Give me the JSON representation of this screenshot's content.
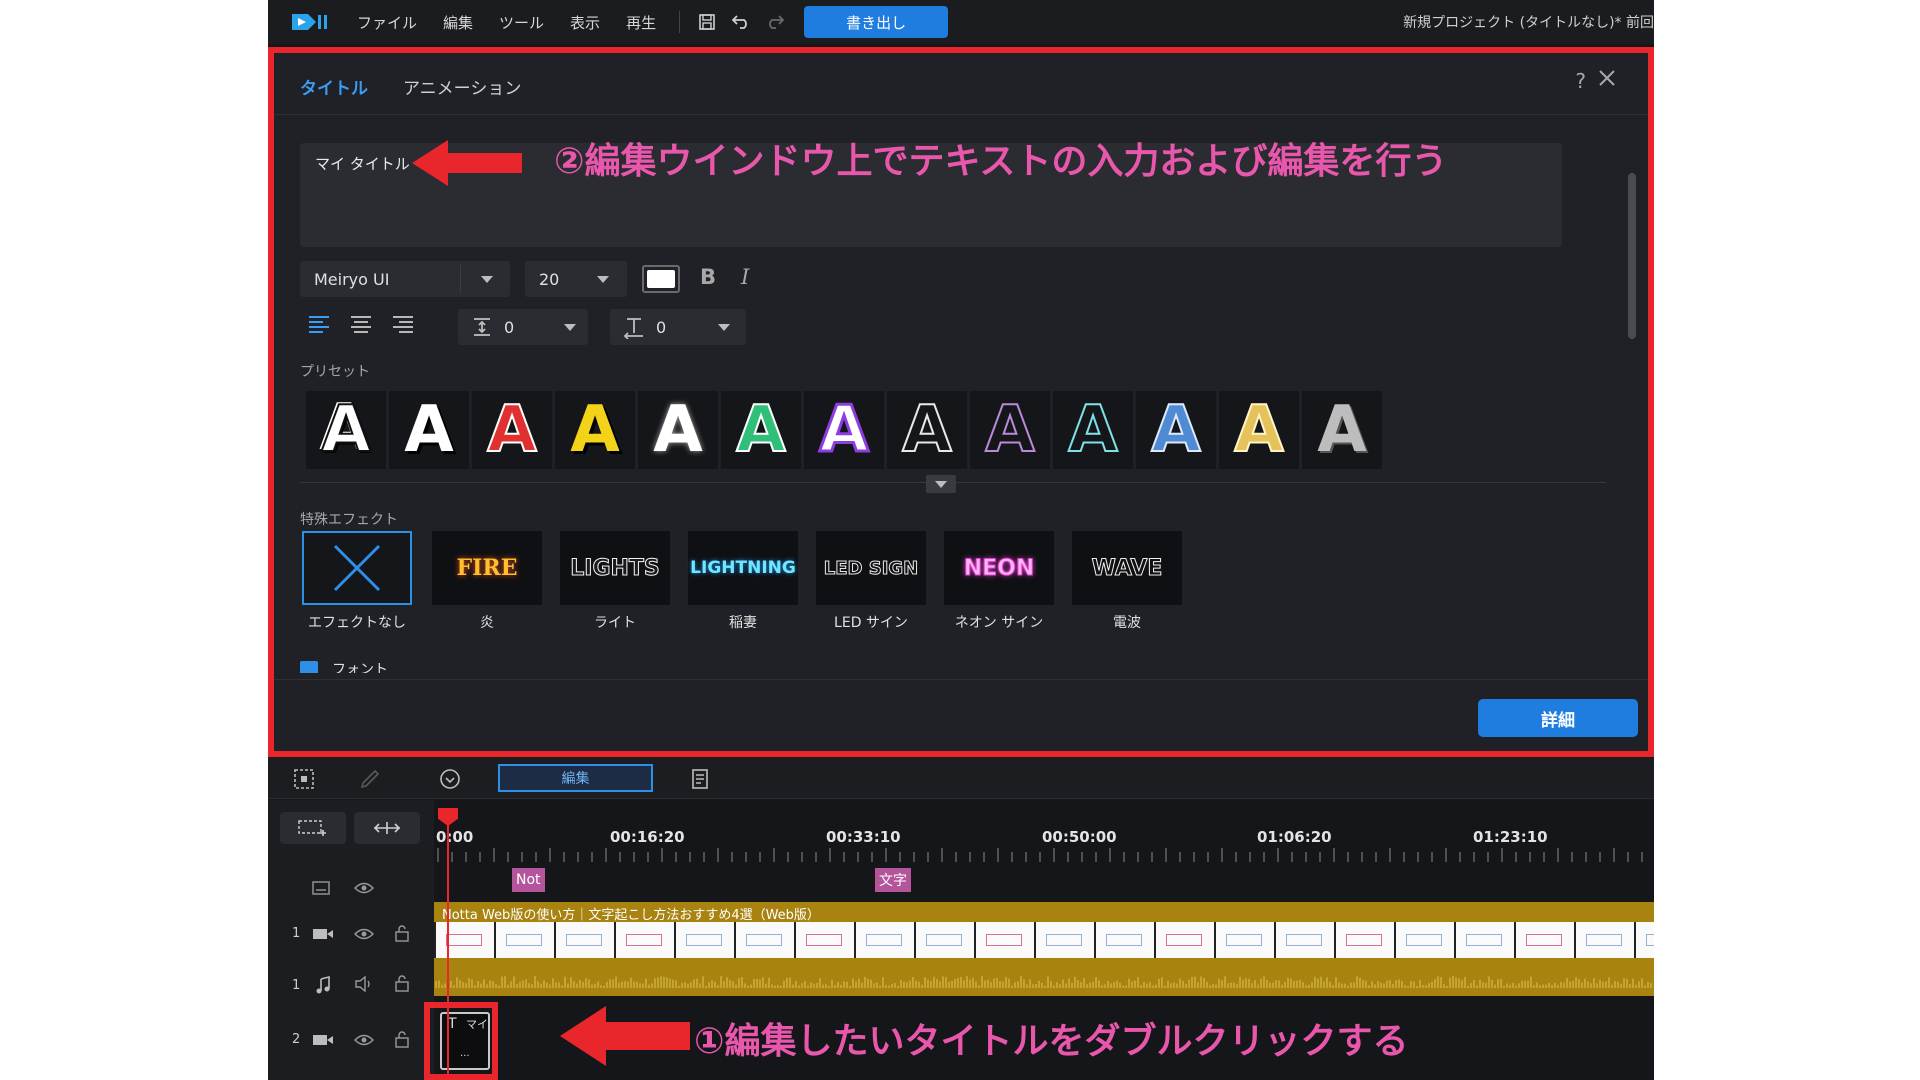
{
  "menu": {
    "items": [
      "ファイル",
      "編集",
      "ツール",
      "表示",
      "再生"
    ],
    "export_label": "書き出し",
    "project_title": "新規プロジェクト (タイトルなし)* 前回"
  },
  "editor": {
    "tabs": {
      "title": "タイトル",
      "animation": "アニメーション"
    },
    "help": "?",
    "text_value": "マイ タイトル",
    "font": "Meiryo UI",
    "size": "20",
    "bold": "B",
    "italic": "I",
    "line_spacing": "0",
    "char_spacing": "0",
    "preset_label": "プリセット",
    "effect_label": "特殊エフェクト",
    "font_section_label": "フォント",
    "details_label": "詳細",
    "text_color": "#ffffff",
    "effects": [
      {
        "caption": "エフェクトなし",
        "thumb": ""
      },
      {
        "caption": "炎",
        "thumb": "FIRE"
      },
      {
        "caption": "ライト",
        "thumb": "LIGHTS"
      },
      {
        "caption": "稲妻",
        "thumb": "LIGHTNING"
      },
      {
        "caption": "LED サイン",
        "thumb": "LED SIGN"
      },
      {
        "caption": "ネオン サイン",
        "thumb": "NEON"
      },
      {
        "caption": "電波",
        "thumb": "WAVE"
      }
    ],
    "preset_glyph": "A"
  },
  "timeline": {
    "edit_tab": "編集",
    "ruler": [
      "0:00",
      "00:16:20",
      "00:33:10",
      "00:50:00",
      "01:06:20",
      "01:23:10"
    ],
    "markers": [
      "Not",
      "文字"
    ],
    "video_clip_label": "Notta Web版の使い方｜文字起こし方法おすすめ4選（Web版）",
    "track_numbers": [
      "1",
      "1",
      "2"
    ],
    "title_clip": {
      "t": "T",
      "name": "マイ",
      "dots": "..."
    }
  },
  "annotations": {
    "top": "②編集ウインドウ上でテキストの入力および編集を行う",
    "bottom": "①編集したいタイトルをダブルクリックする"
  },
  "colors": {
    "accent": "#1f7de0",
    "highlight": "#e8262b",
    "annotation": "#e957ad",
    "clip": "#a98310"
  }
}
